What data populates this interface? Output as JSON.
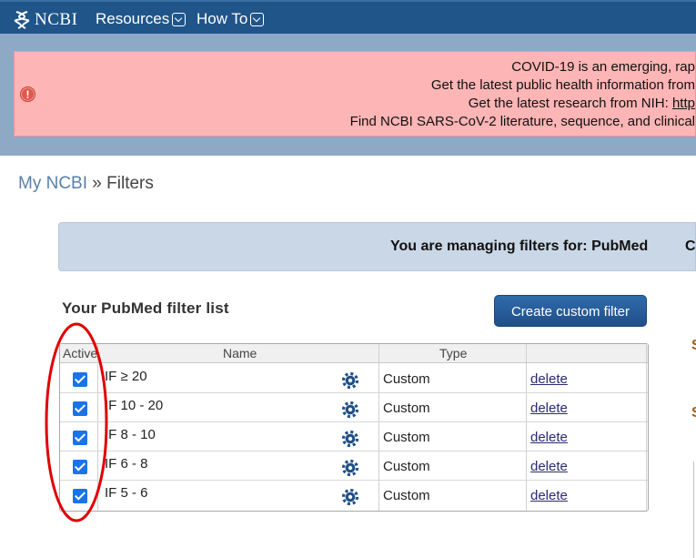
{
  "nav": {
    "logo_text": "NCBI",
    "resources_label": "Resources",
    "howto_label": "How To"
  },
  "alert": {
    "lines": [
      "COVID-19 is an emerging, rap",
      "Get the latest public health information from",
      "Get the latest research from NIH:",
      "Find NCBI SARS-CoV-2 literature, sequence, and clinical"
    ],
    "link_fragment": "http"
  },
  "breadcrumb": {
    "home": "My NCBI",
    "separator": "»",
    "current": "Filters"
  },
  "manage": {
    "text": "You are managing filters for: PubMed",
    "extra": "C"
  },
  "filters": {
    "title": "Your PubMed filter list",
    "create_button": "Create custom filter",
    "columns": [
      "Active",
      "Name",
      "Type",
      ""
    ],
    "rows": [
      {
        "active": true,
        "name": "IF ≥ 20",
        "type": "Custom",
        "action": "delete"
      },
      {
        "active": true,
        "name": "IF 10 - 20",
        "type": "Custom",
        "action": "delete"
      },
      {
        "active": true,
        "name": "IF 8 - 10",
        "type": "Custom",
        "action": "delete"
      },
      {
        "active": true,
        "name": "IF 6 - 8",
        "type": "Custom",
        "action": "delete"
      },
      {
        "active": true,
        "name": "IF 5 - 6",
        "type": "Custom",
        "action": "delete"
      }
    ]
  },
  "right_fragments": [
    "S",
    "S"
  ],
  "colors": {
    "nav_bg": "#20558a",
    "alert_bg": "#fdb5b5",
    "band_bg": "#8ea9c6",
    "annotation": "#e00000"
  }
}
